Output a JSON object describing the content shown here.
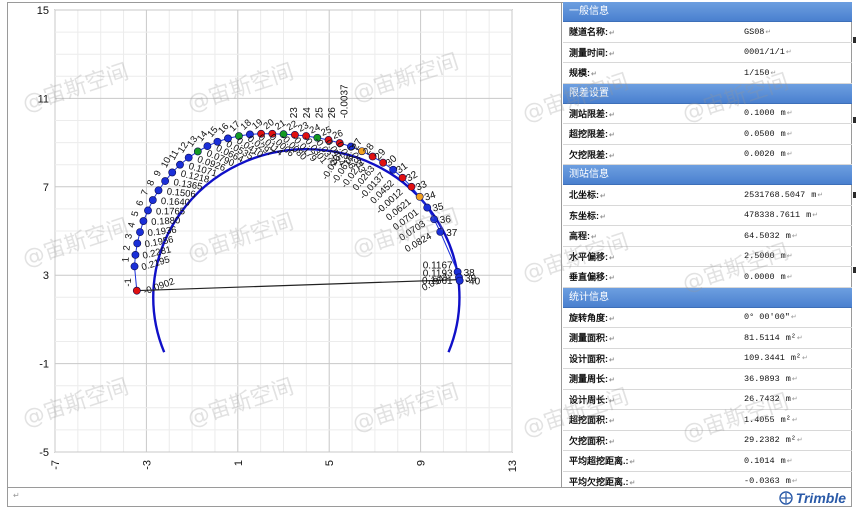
{
  "chart_data": {
    "type": "scatter",
    "xlim": [
      -7,
      13
    ],
    "ylim": [
      -5,
      15
    ],
    "x_ticks": [
      "-7",
      "-3",
      "1",
      "5",
      "9",
      "13"
    ],
    "y_ticks": [
      "15",
      "11",
      "7",
      "3",
      "-1",
      "-5"
    ],
    "grid": true,
    "design_profile": {
      "center": [
        4,
        2
      ],
      "radius": 6.7
    },
    "baseline": {
      "from": [
        -3.5,
        2.3
      ],
      "to": [
        10.7,
        2.8
      ]
    },
    "point_labels": {
      "left_ids": [
        "-1",
        "1",
        "2",
        "3",
        "4",
        "5",
        "6",
        "7",
        "8",
        "9",
        "10",
        "11",
        "12",
        "13",
        "14",
        "15",
        "16",
        "17",
        "18",
        "19",
        "20",
        "21",
        "22",
        "23",
        "24",
        "25",
        "26"
      ],
      "left_deviations": [
        "-0.0902",
        "0.2195",
        "0.2281",
        "0.1956",
        "0.1936",
        "0.1880",
        "0.1765",
        "0.1640",
        "0.1506",
        "0.1365",
        "0.1218",
        "0.1071",
        "0.0926",
        "0.0790",
        "0.0664",
        "0.0535",
        "0.0410",
        "0.0297",
        "0.0114",
        "0.0006",
        "-0.0080",
        "-0.0179",
        "-0.0301",
        "-0.0370",
        "0.0454",
        "0.0356",
        "0.0553"
      ],
      "top_labels": [
        "23",
        "24",
        "25",
        "26",
        "-0.0037"
      ],
      "right_ids": [
        "27",
        "28",
        "29",
        "30",
        "31",
        "32",
        "33",
        "34",
        "35",
        "36",
        "37",
        "38",
        "39",
        "-40"
      ],
      "right_deviations": [
        "-0.0207",
        "-0.0615",
        "-0.0272",
        "0.0263",
        "-0.0137",
        "0.0452",
        "-0.0012",
        "0.0621",
        "0.0701",
        "0.0703",
        "0.0824",
        "0.0941",
        "0.1167",
        "0.1193",
        "0.1661"
      ]
    },
    "points": {
      "x": [
        -3.42,
        -3.52,
        -3.48,
        -3.4,
        -3.28,
        -3.13,
        -2.93,
        -2.72,
        -2.47,
        -2.18,
        -1.87,
        -1.53,
        -1.15,
        -0.75,
        -0.33,
        0.11,
        0.57,
        1.05,
        1.53,
        2.02,
        2.51,
        3.0,
        3.5,
        3.99,
        4.48,
        4.97,
        5.46,
        5.95,
        6.43,
        6.9,
        7.36,
        7.8,
        8.21,
        8.6,
        8.96,
        9.29,
        9.59,
        9.86,
        10.62,
        10.68,
        10.71
      ],
      "y": [
        2.3,
        3.4,
        3.92,
        4.44,
        4.95,
        5.45,
        5.93,
        6.4,
        6.84,
        7.26,
        7.65,
        8.0,
        8.32,
        8.6,
        8.84,
        9.04,
        9.19,
        9.3,
        9.37,
        9.4,
        9.4,
        9.38,
        9.35,
        9.3,
        9.22,
        9.12,
        8.98,
        8.82,
        8.61,
        8.37,
        8.09,
        7.77,
        7.41,
        7.0,
        6.55,
        6.06,
        5.53,
        4.96,
        3.15,
        2.9,
        2.75
      ],
      "color_class": [
        "r",
        "b",
        "b",
        "b",
        "b",
        "b",
        "b",
        "b",
        "b",
        "b",
        "b",
        "b",
        "b",
        "g",
        "b",
        "b",
        "b",
        "g",
        "b",
        "r",
        "r",
        "g",
        "r",
        "r",
        "g",
        "r",
        "r",
        "b",
        "o",
        "r",
        "r",
        "b",
        "r",
        "r",
        "o",
        "b",
        "b",
        "b",
        "b",
        "b",
        "b"
      ]
    },
    "colors": {
      "r": "#e01010",
      "b": "#1a2fd8",
      "g": "#139a23",
      "o": "#f0a020",
      "profile": "#1010c8",
      "line": "#222222"
    }
  },
  "info": {
    "sections": [
      {
        "title": "一般信息",
        "rows": [
          {
            "label": "隧道名称:",
            "value": "GS08",
            "unit": ""
          },
          {
            "label": "测量时间:",
            "value": "0001/1/1",
            "unit": ""
          },
          {
            "label": "规模:",
            "value": "1/150",
            "unit": ""
          }
        ]
      },
      {
        "title": "限差设置",
        "rows": [
          {
            "label": "测站限差:",
            "value": "0.1000",
            "unit": "m"
          },
          {
            "label": "超挖限差:",
            "value": "0.0500",
            "unit": "m"
          },
          {
            "label": "欠挖限差:",
            "value": "0.0020",
            "unit": "m"
          }
        ]
      },
      {
        "title": "测站信息",
        "rows": [
          {
            "label": "北坐标:",
            "value": "2531768.5047",
            "unit": "m"
          },
          {
            "label": "东坐标:",
            "value": "478338.7611",
            "unit": "m"
          },
          {
            "label": "高程:",
            "value": "64.5032",
            "unit": "m"
          },
          {
            "label": "水平偏移:",
            "value": "2.5000",
            "unit": "m"
          },
          {
            "label": "垂直偏移:",
            "value": "0.0000",
            "unit": "m"
          }
        ]
      },
      {
        "title": "统计信息",
        "rows": [
          {
            "label": "旋转角度:",
            "value": "0° 00′00″",
            "unit": ""
          },
          {
            "label": "测量面积:",
            "value": "81.5114",
            "unit": "m²"
          },
          {
            "label": "设计面积:",
            "value": "109.3441",
            "unit": "m²"
          },
          {
            "label": "测量周长:",
            "value": "36.9893",
            "unit": "m"
          },
          {
            "label": "设计周长:",
            "value": "26.7432",
            "unit": "m"
          },
          {
            "label": "超挖面积:",
            "value": "1.4055",
            "unit": "m²"
          },
          {
            "label": "欠挖面积:",
            "value": "29.2382",
            "unit": "m²"
          },
          {
            "label": "平均超挖距离.:",
            "value": "0.1014",
            "unit": "m"
          },
          {
            "label": "平均欠挖距离.:",
            "value": "-0.0363",
            "unit": "m"
          }
        ]
      }
    ]
  },
  "watermark_text": "@宙斯空间",
  "logo_text": "Trimble",
  "para_mark": "↵",
  "icons": {
    "logo": "trimble-logo-icon",
    "para": "paragraph-mark-icon"
  }
}
